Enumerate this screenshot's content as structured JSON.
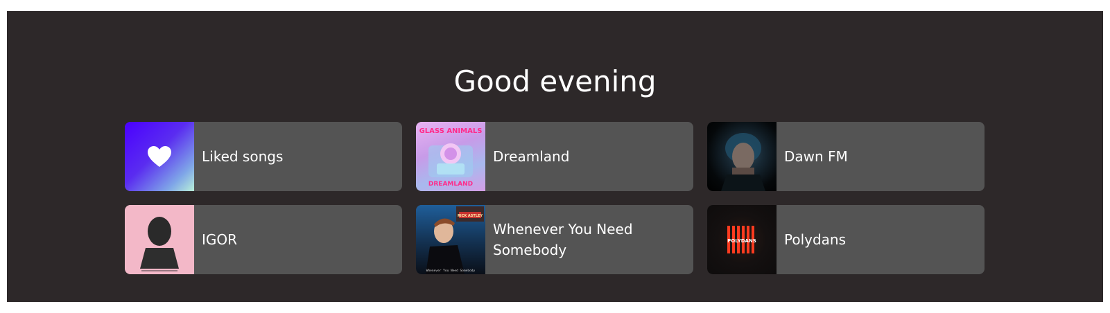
{
  "greeting": "Good evening",
  "colors": {
    "panel_bg": "#2d2829",
    "card_bg": "#545454",
    "text": "#ffffff"
  },
  "cards": [
    {
      "label": "Liked songs",
      "cover": "heart-icon"
    },
    {
      "label": "Dreamland",
      "cover": "dreamland-album-cover"
    },
    {
      "label": "Dawn FM",
      "cover": "dawn-fm-album-cover"
    },
    {
      "label": "IGOR",
      "cover": "igor-album-cover"
    },
    {
      "label": "Whenever You Need Somebody",
      "cover": "whenever-you-need-somebody-album-cover"
    },
    {
      "label": "Polydans",
      "cover": "polydans-album-cover"
    }
  ],
  "cover_art_text": {
    "dreamland_top": "GLASS ANIMALS",
    "dreamland_bottom": "DREAMLAND",
    "rick_badge": "RICK ASTLEY",
    "rick_bottom": "Whenever You Need Somebody",
    "polydans": "POLYDANS"
  }
}
